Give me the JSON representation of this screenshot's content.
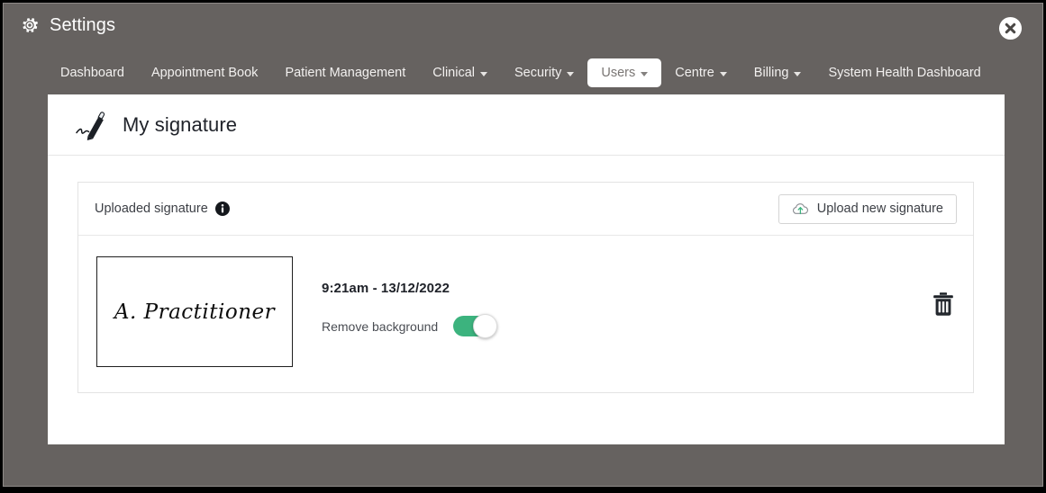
{
  "window": {
    "title": "Settings",
    "title_icon": "gear-icon",
    "close_icon": "close-circle-icon",
    "background_color": "#666260"
  },
  "nav": {
    "items": [
      {
        "label": "Dashboard",
        "has_caret": false,
        "active": false
      },
      {
        "label": "Appointment Book",
        "has_caret": false,
        "active": false
      },
      {
        "label": "Patient Management",
        "has_caret": false,
        "active": false
      },
      {
        "label": "Clinical",
        "has_caret": true,
        "active": false
      },
      {
        "label": "Security",
        "has_caret": true,
        "active": false
      },
      {
        "label": "Users",
        "has_caret": true,
        "active": true
      },
      {
        "label": "Centre",
        "has_caret": true,
        "active": false
      },
      {
        "label": "Billing",
        "has_caret": true,
        "active": false
      },
      {
        "label": "System Health Dashboard",
        "has_caret": false,
        "active": false
      }
    ]
  },
  "page": {
    "heading": "My signature",
    "heading_icon": "signature-pen-icon"
  },
  "card": {
    "header_label": "Uploaded signature",
    "info_icon": "info-circle-icon",
    "upload_button": {
      "label": "Upload new signature",
      "icon": "cloud-upload-icon",
      "icon_color": "#3cb37e"
    },
    "signature": {
      "image_text": "A. Practitioner",
      "timestamp": "9:21am - 13/12/2022",
      "remove_background_label": "Remove background",
      "remove_background_on": true,
      "toggle_on_color": "#3cb37e",
      "delete_icon": "trash-icon"
    }
  }
}
